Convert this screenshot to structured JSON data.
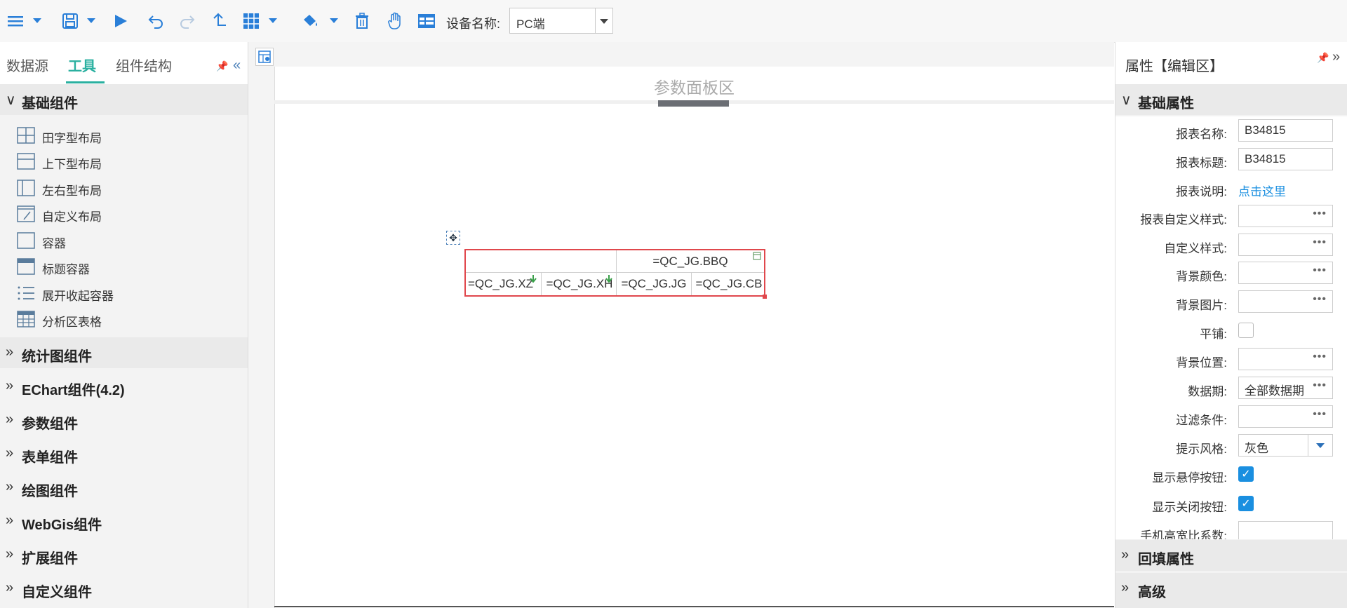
{
  "toolbar": {
    "device_label": "设备名称:",
    "device_value": "PC端",
    "icons": [
      "menu-icon",
      "save-icon",
      "run-icon",
      "undo-icon",
      "redo-icon",
      "upload-icon",
      "layout-grid-icon",
      "paint-bucket-icon",
      "delete-icon",
      "hand-icon",
      "preview-icon"
    ]
  },
  "left": {
    "tabs": [
      {
        "label": "数据源"
      },
      {
        "label": "工具"
      },
      {
        "label": "组件结构"
      }
    ],
    "basic_section": "基础组件",
    "tools": [
      {
        "label": "田字型布局"
      },
      {
        "label": "上下型布局"
      },
      {
        "label": "左右型布局"
      },
      {
        "label": "自定义布局"
      },
      {
        "label": "容器"
      },
      {
        "label": "标题容器"
      },
      {
        "label": "展开收起容器"
      },
      {
        "label": "分析区表格"
      }
    ],
    "sections": [
      {
        "label": "统计图组件"
      },
      {
        "label": "EChart组件(4.2)"
      },
      {
        "label": "参数组件"
      },
      {
        "label": "表单组件"
      },
      {
        "label": "绘图组件"
      },
      {
        "label": "WebGis组件"
      },
      {
        "label": "扩展组件"
      },
      {
        "label": "自定义组件"
      }
    ]
  },
  "canvas": {
    "param_panel_title": "参数面板区",
    "report": {
      "header": "=QC_JG.BBQ",
      "cells": [
        "=QC_JG.XZ",
        "=QC_JG.XH",
        "=QC_JG.JG",
        "=QC_JG.CB"
      ]
    }
  },
  "right": {
    "title": "属性【编辑区】",
    "basic_section": "基础属性",
    "props": {
      "report_name_label": "报表名称:",
      "report_name_value": "B34815",
      "report_title_label": "报表标题:",
      "report_title_value": "B34815",
      "report_desc_label": "报表说明:",
      "report_desc_link": "点击这里",
      "custom_report_style_label": "报表自定义样式:",
      "custom_style_label": "自定义样式:",
      "bg_color_label": "背景颜色:",
      "bg_image_label": "背景图片:",
      "tile_label": "平铺:",
      "bg_position_label": "背景位置:",
      "data_period_label": "数据期:",
      "data_period_value": "全部数据期",
      "filter_label": "过滤条件:",
      "tip_style_label": "提示风格:",
      "tip_style_value": "灰色",
      "show_hover_label": "显示悬停按钮:",
      "show_close_label": "显示关闭按钮:",
      "mobile_ratio_label": "手机高宽比系数:"
    },
    "dots": "•••",
    "sections": [
      {
        "label": "回填属性"
      },
      {
        "label": "高级"
      }
    ]
  },
  "colors": {
    "accent": "#2ab0a0",
    "link": "#1a8fe0",
    "selection": "#e0474c",
    "icon": "#2a7fd8"
  }
}
